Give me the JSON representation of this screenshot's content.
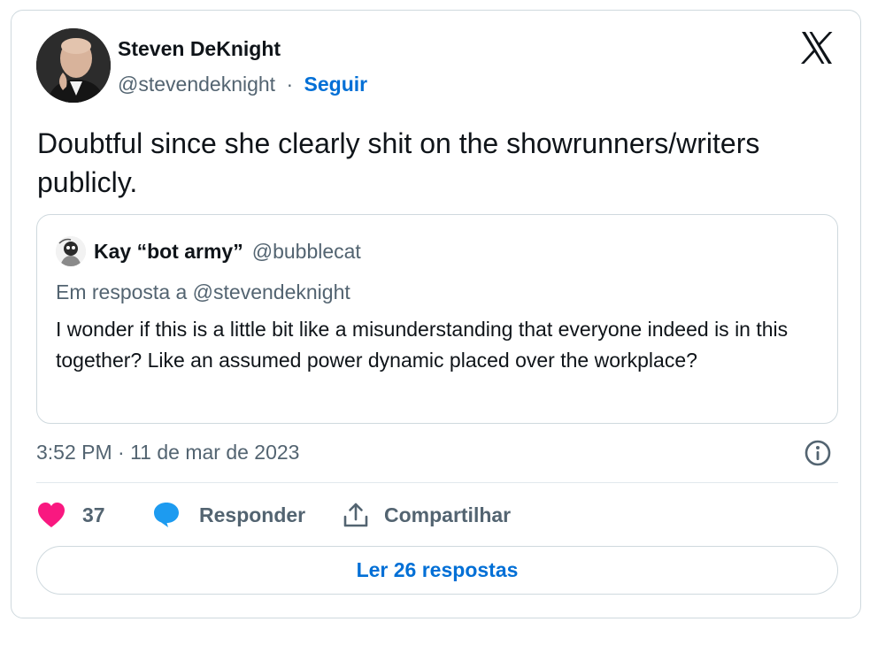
{
  "author": {
    "name": "Steven DeKnight",
    "handle": "@stevendeknight",
    "separator": "·",
    "follow_label": "Seguir"
  },
  "tweet": {
    "text": "Doubtful since she clearly shit on the showrunners/writers publicly."
  },
  "quote": {
    "name": "Kay “bot army”",
    "handle": "@bubblecat",
    "reply_to": "Em resposta a @stevendeknight",
    "text": "I wonder if this is a little bit like a misunderstanding that everyone indeed is in this together? Like an assumed power dynamic placed over the workplace?"
  },
  "meta": {
    "timestamp": "3:52 PM · 11 de mar de 2023"
  },
  "actions": {
    "like_count": "37",
    "reply_label": "Responder",
    "share_label": "Compartilhar"
  },
  "read_replies_label": "Ler 26 respostas",
  "icons": {
    "brand": "x-logo-icon",
    "info": "info-icon",
    "like": "heart-icon",
    "reply": "speech-bubble-icon",
    "share": "share-upload-icon"
  },
  "colors": {
    "link_blue": "#006fd6",
    "like_pink": "#f91880",
    "reply_blue": "#1d9bf0",
    "muted_gray": "#536471",
    "text": "#0f1419",
    "border": "#cfd9de"
  }
}
